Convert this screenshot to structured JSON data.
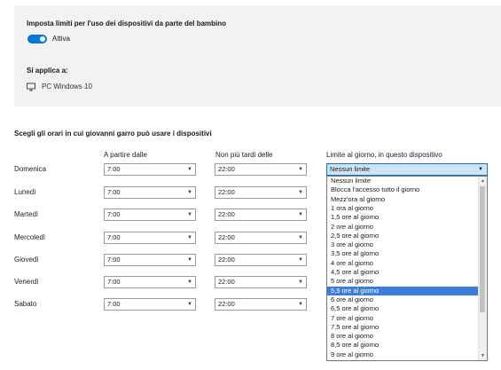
{
  "settings": {
    "title": "Imposta limiti per l'uso dei dispositivi da parte del bambino",
    "toggle_label": "Attiva",
    "applies_title": "Si applica a:",
    "device_icon": "monitor-icon",
    "device_name": "PC Windows 10"
  },
  "schedule": {
    "title": "Scegli gli orari in cui giovanni garro può usare i dispositivi",
    "col_from": "A partire dalle",
    "col_to": "Non più tardi delle",
    "col_limit": "Limite al giorno, in questo dispositivo",
    "days": [
      {
        "name": "Domenica",
        "from": "7:00",
        "to": "22:00"
      },
      {
        "name": "Lunedì",
        "from": "7:00",
        "to": "22:00"
      },
      {
        "name": "Martedì",
        "from": "7:00",
        "to": "22:00"
      },
      {
        "name": "Mercoledì",
        "from": "7:00",
        "to": "22:00"
      },
      {
        "name": "Giovedì",
        "from": "7:00",
        "to": "22:00"
      },
      {
        "name": "Venerdì",
        "from": "7:00",
        "to": "22:00"
      },
      {
        "name": "Sabato",
        "from": "7:00",
        "to": "22:00"
      }
    ],
    "limit_value": "Nessun limite",
    "limit_options": [
      "Nessun limite",
      "Blocca l'accesso tutto il giorno",
      "Mezz'ora al giorno",
      "1 ora al giorno",
      "1,5 ore al giorno",
      "2 ore al giorno",
      "2,5 ore al giorno",
      "3 ore al giorno",
      "3,5 ore al giorno",
      "4 ore al giorno",
      "4,5 ore al giorno",
      "5 ore al giorno",
      "5,5 ore al giorno",
      "6 ore al giorno",
      "6,5 ore al giorno",
      "7 ore al giorno",
      "7,5 ore al giorno",
      "8 ore al giorno",
      "8,5 ore al giorno",
      "9 ore al giorno"
    ],
    "highlighted_option": "5,5 ore al giorno"
  },
  "colors": {
    "accent": "#0078d7",
    "highlight": "#3c7dd9",
    "panel_bg": "#f2f2f2"
  }
}
